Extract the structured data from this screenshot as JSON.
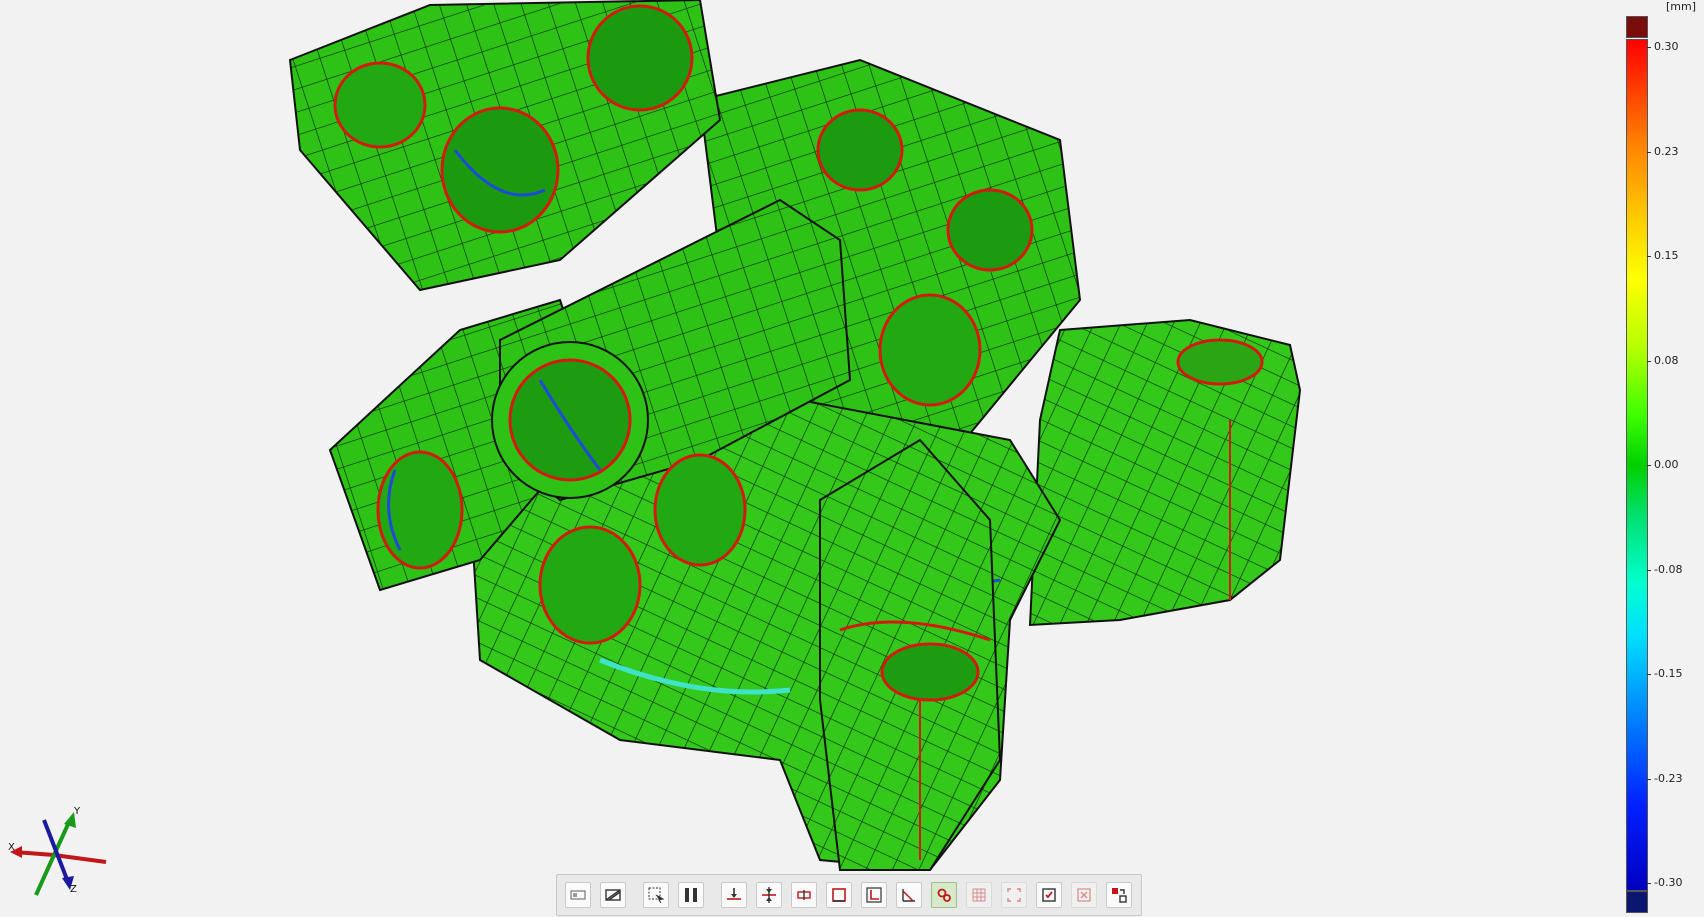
{
  "color_scale": {
    "unit": "[mm]",
    "labels": [
      "0.30",
      "0.23",
      "0.15",
      "0.08",
      "0.00",
      "-0.08",
      "-0.15",
      "-0.23",
      "-0.30"
    ]
  },
  "axes": {
    "x": "X",
    "y": "Y",
    "z": "Z"
  },
  "toolbar": {
    "buttons": [
      {
        "name": "display-mode-icon"
      },
      {
        "name": "hide-show-icon"
      },
      {
        "name": "select-region-icon"
      },
      {
        "name": "split-view-icon"
      },
      {
        "name": "align-bottom-icon"
      },
      {
        "name": "align-center-icon"
      },
      {
        "name": "section-icon"
      },
      {
        "name": "frame-icon"
      },
      {
        "name": "datum-icon"
      },
      {
        "name": "angle-measure-icon"
      },
      {
        "name": "deviation-points-icon"
      },
      {
        "name": "grid-mesh-icon"
      },
      {
        "name": "fit-view-icon"
      },
      {
        "name": "checklist-icon"
      },
      {
        "name": "delete-icon"
      },
      {
        "name": "report-export-icon"
      }
    ]
  },
  "colors": {
    "surface_green": "#2fc216",
    "mesh_line": "#111111",
    "edge_red": "#e02010",
    "edge_blue": "#1b4bd8",
    "edge_cyan": "#3ee3c8"
  }
}
